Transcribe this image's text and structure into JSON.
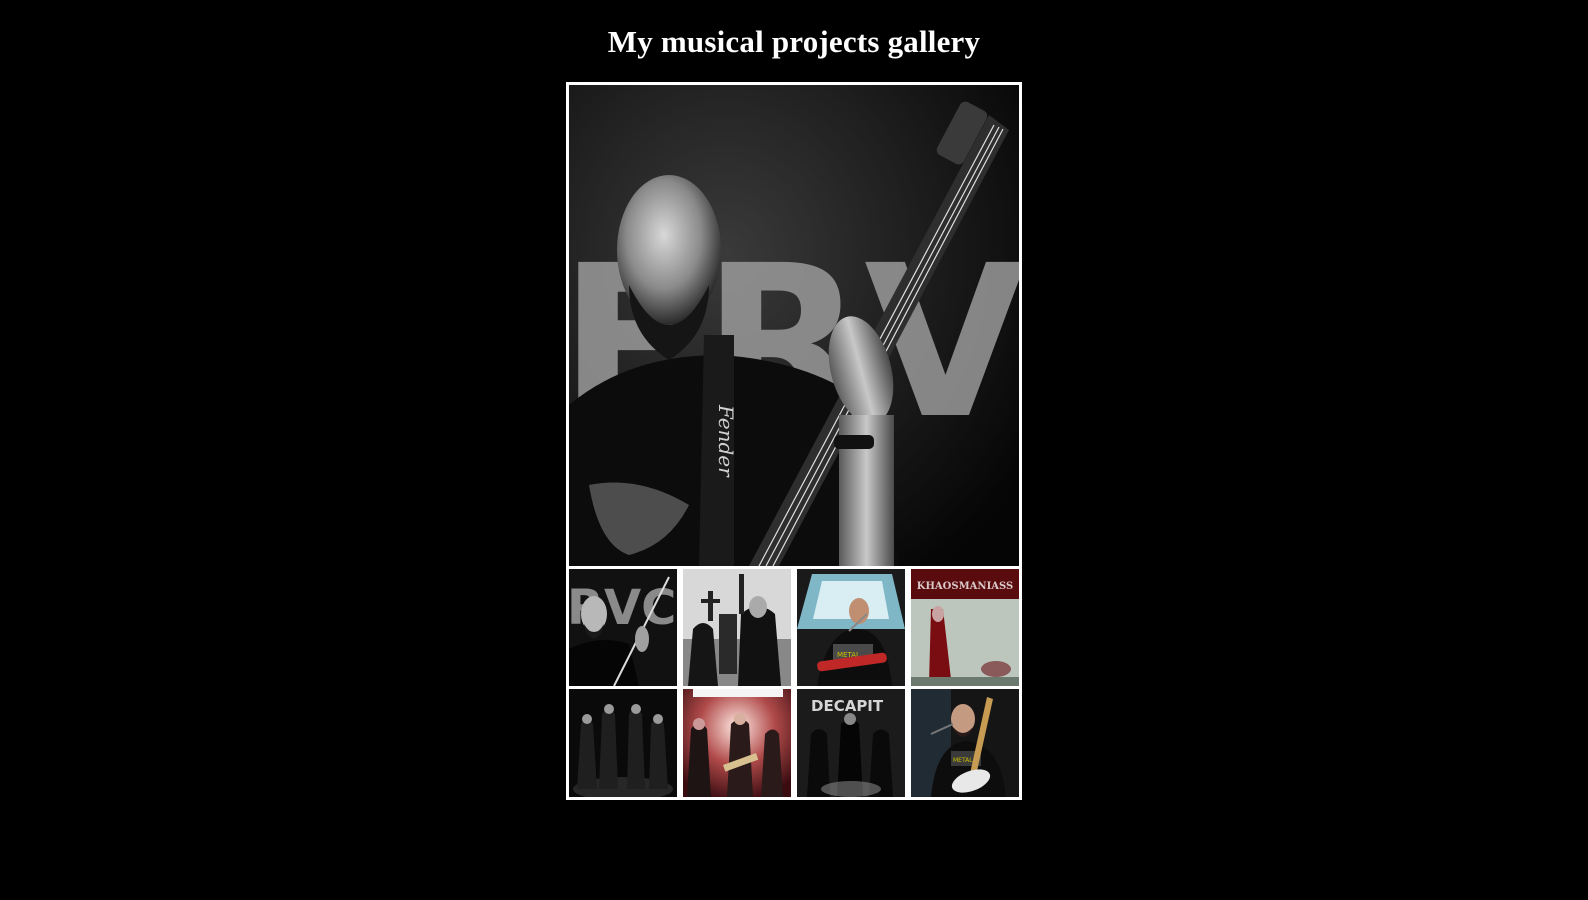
{
  "page": {
    "title": "My musical projects gallery",
    "background_color": "#000000",
    "frame_color": "#ffffff"
  },
  "gallery": {
    "main_photo": {
      "icon": "photo-bass-player-bw",
      "backdrop_text": "ERVC",
      "strap_text": "Fender"
    },
    "thumbnails": [
      {
        "icon": "photo-bass-player-bw"
      },
      {
        "icon": "photo-band-graveyard-bw"
      },
      {
        "icon": "photo-singer-stage-color"
      },
      {
        "icon": "photo-album-cover-red",
        "cover_text": "KHAOSMANIASS"
      },
      {
        "icon": "photo-band-forest-bw"
      },
      {
        "icon": "photo-band-live-stage-color"
      },
      {
        "icon": "photo-band-backdrop-bw",
        "backdrop_text": "DECAPITATOR"
      },
      {
        "icon": "photo-guitarist-singing-color"
      }
    ]
  }
}
